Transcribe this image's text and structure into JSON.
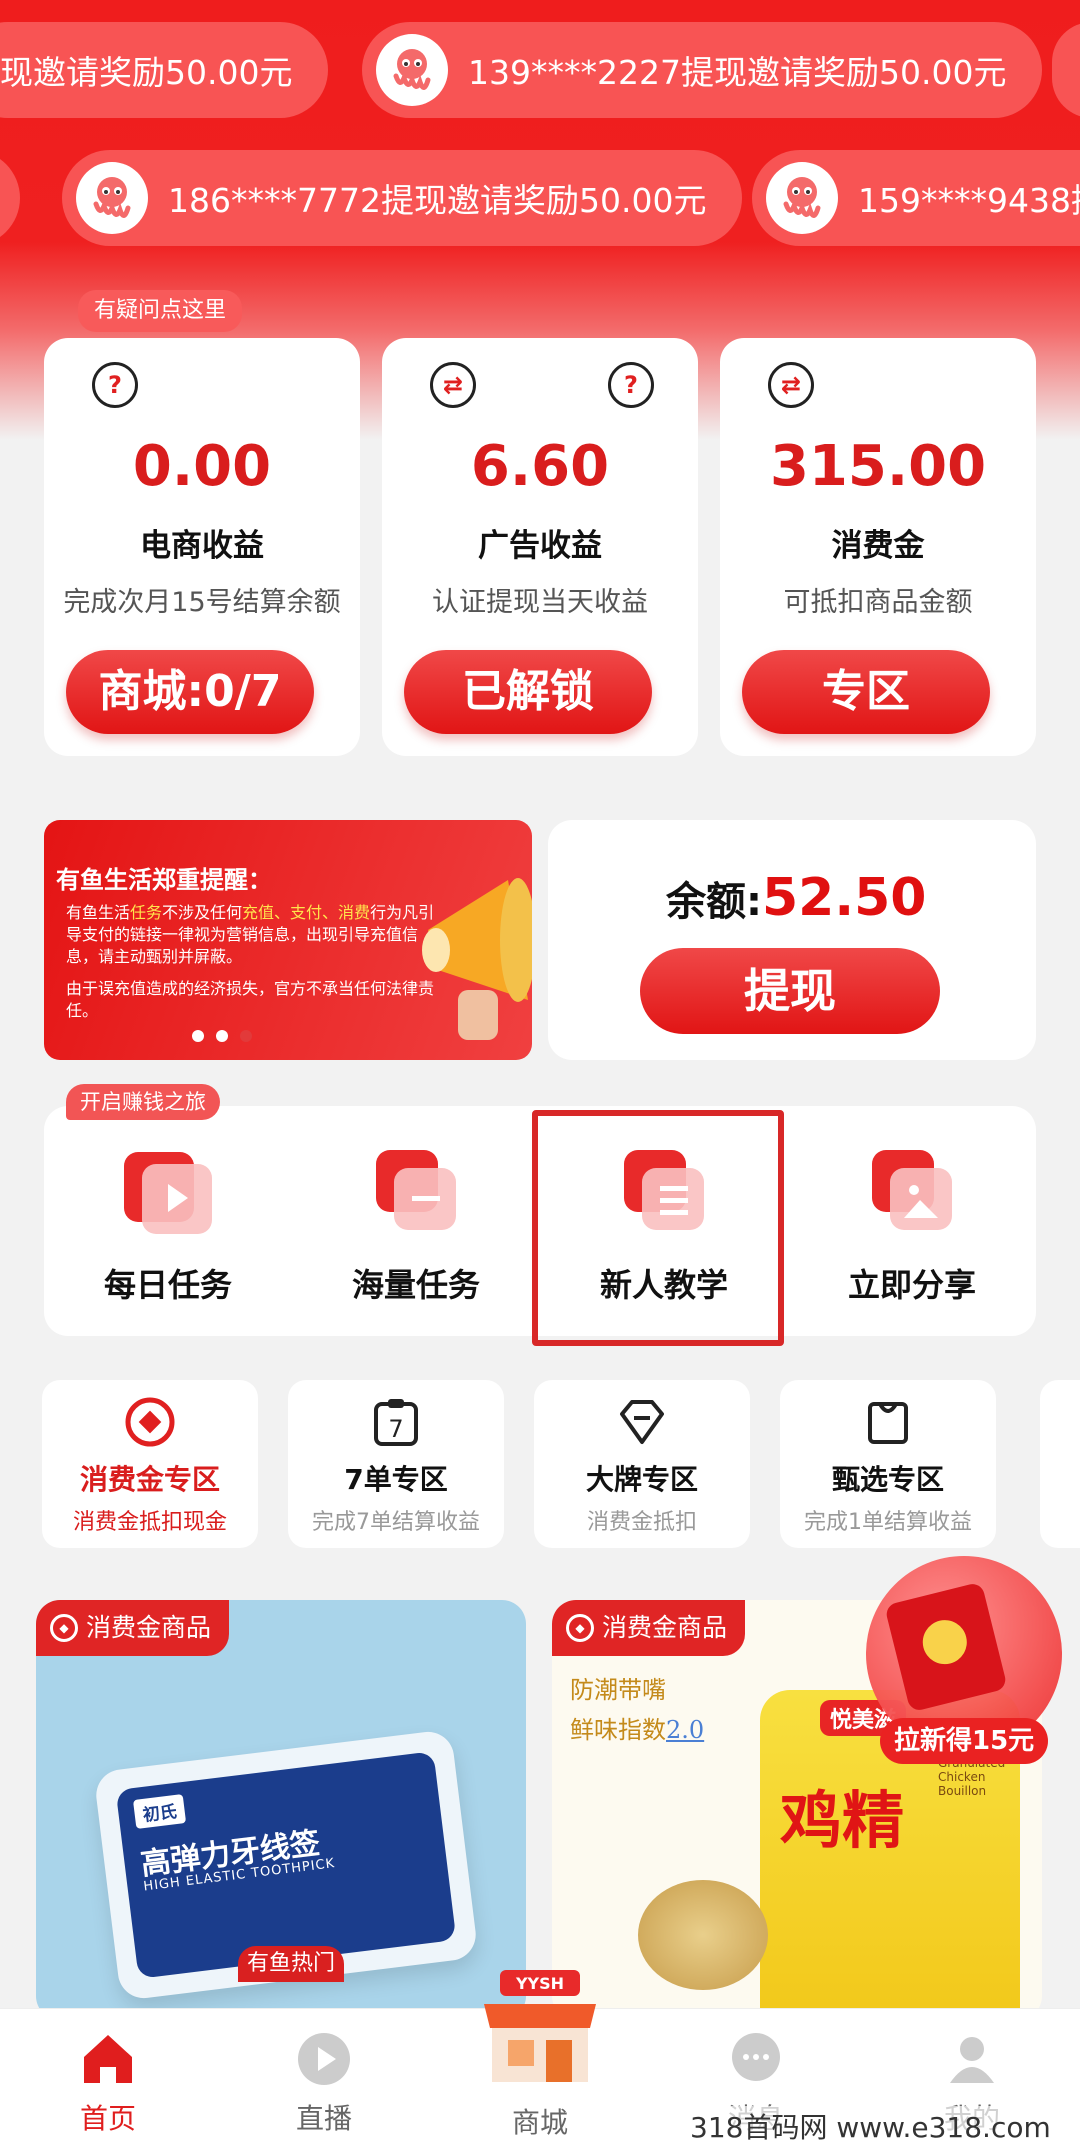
{
  "ticker": {
    "row1": [
      "139****2227提现邀请奖励50.00元",
      "现邀请奖励50.00元"
    ],
    "row2": [
      "186****7772提现邀请奖励50.00元",
      "159****9438提"
    ]
  },
  "help_tag": "有疑问点这里",
  "stats": [
    {
      "value": "0.00",
      "title": "电商收益",
      "subtitle": "完成次月15号结算余额",
      "button": "商城:0/7"
    },
    {
      "value": "6.60",
      "title": "广告收益",
      "subtitle": "认证提现当天收益",
      "button": "已解锁"
    },
    {
      "value": "315.00",
      "title": "消费金",
      "subtitle": "可抵扣商品金额",
      "button": "专区"
    }
  ],
  "notice": {
    "title": "有鱼生活郑重提醒：",
    "p1_a": "有鱼生活",
    "p1_b": "任务",
    "p1_c": "不涉及任何",
    "p1_d": "充值、支付、消费",
    "p1_e": "行为凡引导支付的链接一律视为营销信息，出现引导充值信息，请主动甄别并屏蔽。",
    "p2": "由于误充值造成的经济损失，官方不承当任何法律责任。"
  },
  "balance": {
    "label": "余额:",
    "amount": "52.50",
    "button": "提现"
  },
  "earn_tag": "开启赚钱之旅",
  "tasks": [
    "每日任务",
    "海量任务",
    "新人教学",
    "立即分享"
  ],
  "zones": [
    {
      "title": "消费金专区",
      "subtitle": "消费金抵扣现金"
    },
    {
      "title": "7单专区",
      "subtitle": "完成7单结算收益"
    },
    {
      "title": "大牌专区",
      "subtitle": "消费金抵扣"
    },
    {
      "title": "甄选专区",
      "subtitle": "完成1单结算收益"
    }
  ],
  "products": [
    {
      "tag": "消费金商品",
      "brand": "初氏",
      "name": "高弹力牙线签",
      "name_en": "HIGH ELASTIC TOOTHPICK",
      "badge": "有鱼热门"
    },
    {
      "tag": "消费金商品",
      "slogan1": "防潮带嘴",
      "slogan2": "鲜味指数",
      "slogan2_val": "2.0",
      "brand": "悦美滋",
      "name": "鸡精",
      "name_en": "Granulated Chicken Bouillon"
    }
  ],
  "gift": {
    "label": "拉新得15元"
  },
  "tabbar": [
    "首页",
    "直播",
    "商城",
    "消息",
    "我的"
  ],
  "shop_sign": "YYSH",
  "watermark": "318首码网 www.e318.com"
}
